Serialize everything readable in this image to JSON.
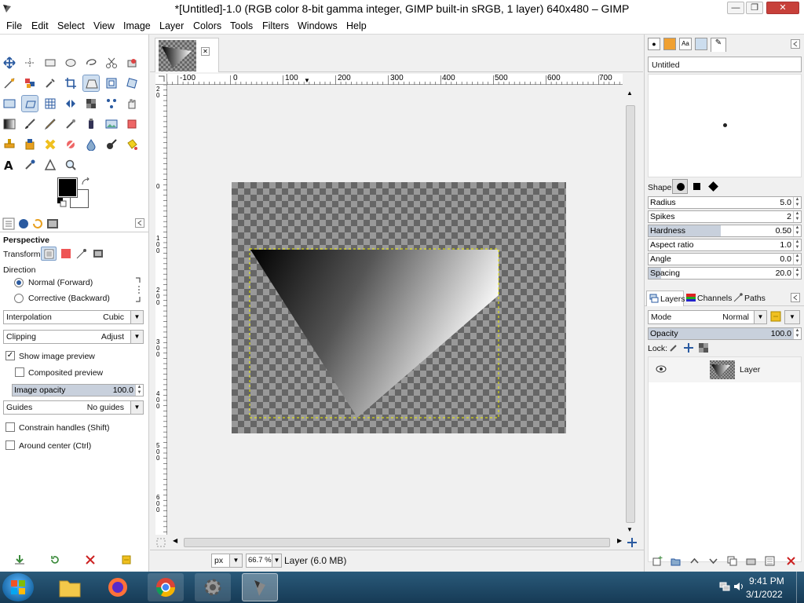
{
  "window": {
    "title": "*[Untitled]-1.0 (RGB color 8-bit gamma integer, GIMP built-in sRGB, 1 layer) 640x480 – GIMP",
    "minimize": "—",
    "restore": "❐",
    "close": "✕"
  },
  "menu": [
    "File",
    "Edit",
    "Select",
    "View",
    "Image",
    "Layer",
    "Colors",
    "Tools",
    "Filters",
    "Windows",
    "Help"
  ],
  "tool_options": {
    "title": "Perspective",
    "transform_label": "Transform:",
    "direction_label": "Direction",
    "direction_normal": "Normal (Forward)",
    "direction_corrective": "Corrective (Backward)",
    "interpolation_label": "Interpolation",
    "interpolation_value": "Cubic",
    "clipping_label": "Clipping",
    "clipping_value": "Adjust",
    "show_preview": "Show image preview",
    "composited_preview": "Composited preview",
    "image_opacity_label": "Image opacity",
    "image_opacity_value": "100.0",
    "guides_label": "Guides",
    "guides_value": "No guides",
    "constrain_handles": "Constrain handles (Shift)",
    "around_center": "Around center (Ctrl)"
  },
  "ruler": {
    "h_labels": [
      "-100",
      "0",
      "100",
      "200",
      "300",
      "400",
      "500",
      "600",
      "700"
    ],
    "v_labels": [
      "0",
      "1 0 0",
      "2 0 0",
      "3 0 0",
      "4 0 0",
      "5 0 0",
      "6 0 0"
    ],
    "v_top": "2 0"
  },
  "statusbar": {
    "unit": "px",
    "zoom": "66.7 %",
    "info": "Layer (6.0 MB)"
  },
  "brushes": {
    "name": "Untitled",
    "shape_label": "Shape:",
    "radius_label": "Radius",
    "radius_value": "5.0",
    "spikes_label": "Spikes",
    "spikes_value": "2",
    "hardness_label": "Hardness",
    "hardness_value": "0.50",
    "hardness": 0.5,
    "aspect_label": "Aspect ratio",
    "aspect_value": "1.0",
    "angle_label": "Angle",
    "angle_value": "0.0",
    "spacing_label": "Spacing",
    "spacing_value": "20.0",
    "spacing": 0.2
  },
  "layers_panel": {
    "tabs": [
      "Layers",
      "Channels",
      "Paths"
    ],
    "mode_label": "Mode",
    "mode_value": "Normal",
    "opacity_label": "Opacity",
    "opacity_value": "100.0",
    "lock_label": "Lock:",
    "layer_name": "Layer"
  },
  "taskbar": {
    "time": "9:41 PM",
    "date": "3/1/2022"
  }
}
